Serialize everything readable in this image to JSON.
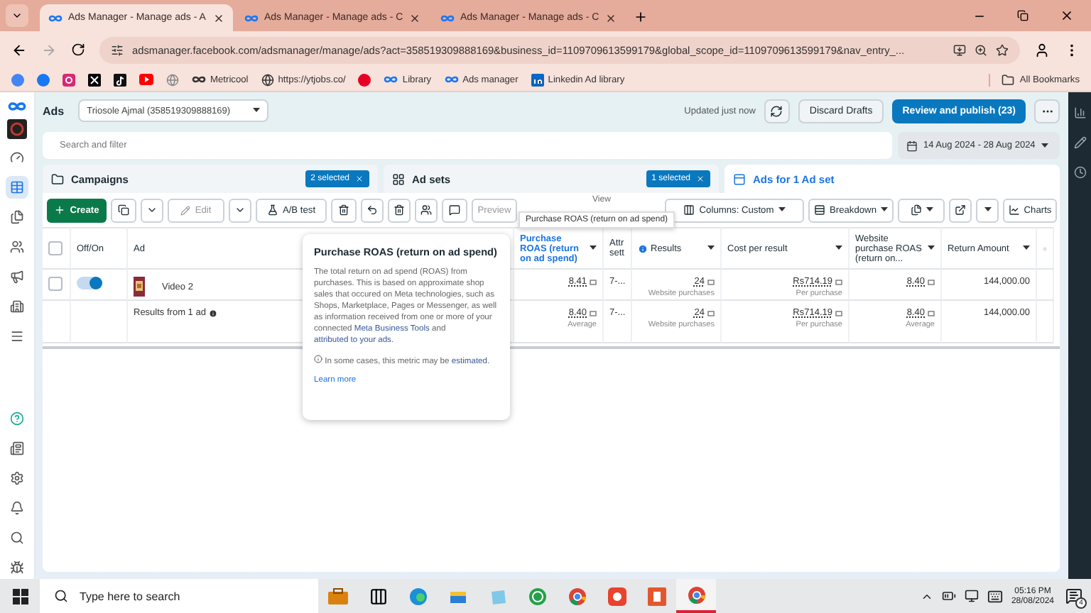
{
  "browser": {
    "tabs": [
      {
        "title": "Ads Manager - Manage ads - A",
        "selected": true
      },
      {
        "title": "Ads Manager - Manage ads - C",
        "selected": false
      },
      {
        "title": "Ads Manager - Manage ads - C",
        "selected": false
      }
    ],
    "url": "adsmanager.facebook.com/adsmanager/manage/ads?act=358519309888169&business_id=1109709613599179&global_scope_id=1109709613599179&nav_entry_...",
    "bookmarks": [
      {
        "kind": "google"
      },
      {
        "kind": "facebook"
      },
      {
        "kind": "instagram"
      },
      {
        "kind": "x"
      },
      {
        "kind": "tiktok"
      },
      {
        "kind": "youtube"
      },
      {
        "kind": "globe"
      },
      {
        "kind": "metricool",
        "label": "Metricool"
      },
      {
        "kind": "world",
        "label": "https://ytjobs.co/"
      },
      {
        "kind": "pinterest"
      },
      {
        "kind": "meta",
        "label": "Library"
      },
      {
        "kind": "meta",
        "label": "Ads manager"
      },
      {
        "kind": "linkedin",
        "label": "Linkedin Ad library"
      }
    ],
    "all_bookmarks": "All Bookmarks"
  },
  "header": {
    "app": "Ads",
    "account": "Triosole Ajmal (358519309888169)",
    "updated": "Updated just now",
    "discard": "Discard Drafts",
    "publish": "Review and publish (23)"
  },
  "search": {
    "placeholder": "Search and filter"
  },
  "date_range": "14 Aug 2024 - 28 Aug 2024",
  "sidebar": {
    "items": [
      {
        "kind": "gauge",
        "selected": false
      },
      {
        "kind": "table",
        "selected": true
      },
      {
        "kind": "pages",
        "selected": false
      },
      {
        "kind": "people",
        "selected": false
      },
      {
        "kind": "megaphone",
        "selected": false
      },
      {
        "kind": "buildings",
        "selected": false
      },
      {
        "kind": "menu",
        "selected": false
      }
    ],
    "bottom": [
      {
        "kind": "help"
      },
      {
        "kind": "news"
      },
      {
        "kind": "settings"
      },
      {
        "kind": "bell"
      },
      {
        "kind": "search"
      },
      {
        "kind": "bug"
      }
    ]
  },
  "levels": [
    {
      "kind": "folder",
      "label": "Campaigns",
      "badge": "2 selected",
      "selected": false
    },
    {
      "kind": "grid",
      "label": "Ad sets",
      "badge": "1 selected",
      "selected": false
    },
    {
      "kind": "ad",
      "label": "Ads for 1 Ad set",
      "selected": true
    }
  ],
  "toolbar": {
    "create": "Create",
    "edit": "Edit",
    "ab_test": "A/B test",
    "preview": "Preview",
    "view": "View",
    "columns": "Columns: Custom",
    "breakdown": "Breakdown",
    "charts": "Charts"
  },
  "table": {
    "columns": [
      {
        "kind": "checkbox",
        "checked": false
      },
      {
        "kind": "text",
        "label": "Off/On",
        "menu": false,
        "highlighted": false
      },
      {
        "kind": "text",
        "label": "Ad",
        "menu": false,
        "highlighted": false
      },
      {
        "kind": "text",
        "label": "Purchase ROAS (return on ad spend)",
        "menu": true,
        "highlighted": true
      },
      {
        "kind": "text",
        "label": "Attr sett",
        "menu": false,
        "highlighted": false
      },
      {
        "kind": "text",
        "label": "Results",
        "menu": true,
        "highlighted": false,
        "info": true
      },
      {
        "kind": "text",
        "label": "Cost per result",
        "menu": true,
        "highlighted": false
      },
      {
        "kind": "text",
        "label": "Website purchase ROAS (return on...",
        "menu": true,
        "highlighted": false
      },
      {
        "kind": "text",
        "label": "Return Amount",
        "menu": true,
        "highlighted": false
      }
    ],
    "rows": [
      {
        "cells": [
          {
            "kind": "checkbox",
            "checked": false
          },
          {
            "kind": "toggle",
            "on": true
          },
          {
            "kind": "ad",
            "value": "Video 2"
          },
          {
            "kind": "metric",
            "value": "8.41"
          },
          {
            "kind": "text",
            "value": "7-..."
          },
          {
            "kind": "metric",
            "value": "24",
            "sub": "Website purchases"
          },
          {
            "kind": "metric",
            "value": "Rs714.19",
            "sub": "Per purchase"
          },
          {
            "kind": "metric",
            "value": "8.40"
          },
          {
            "kind": "number",
            "value": "144,000.00"
          }
        ]
      },
      {
        "cells": [
          {
            "kind": "empty"
          },
          {
            "kind": "empty"
          },
          {
            "kind": "summary",
            "value": "Results from 1 ad"
          },
          {
            "kind": "metric",
            "value": "8.40",
            "sub": "Average"
          },
          {
            "kind": "text",
            "value": "7-..."
          },
          {
            "kind": "metric",
            "value": "24",
            "sub": "Website purchases"
          },
          {
            "kind": "metric",
            "value": "Rs714.19",
            "sub": "Per purchase"
          },
          {
            "kind": "metric",
            "value": "8.40",
            "sub": "Average"
          },
          {
            "kind": "number",
            "value": "144,000.00"
          }
        ]
      }
    ]
  },
  "tooltip": "Purchase ROAS (return on ad spend)",
  "popover": {
    "title": "Purchase ROAS (return on ad spend)",
    "body": [
      {
        "text": "The total return on ad spend (ROAS) from purchases. This is based on approximate shop sales that occured on Meta technologies, such as Shops, Marketplace, Pages or Messenger, as well as information received from one or more of your connected ",
        "link": false
      },
      {
        "text": "Meta Business Tools",
        "link": true
      },
      {
        "text": " and ",
        "link": false
      },
      {
        "text": "attributed to your ads",
        "link": true
      },
      {
        "text": ".",
        "link": false
      }
    ],
    "note": {
      "text": "In some cases, this metric may be ",
      "link": "estimated",
      "end": "."
    },
    "learn_more": "Learn more"
  },
  "taskbar": {
    "search_placeholder": "Type here to search",
    "apps": [
      {
        "kind": "briefcase",
        "active": false
      },
      {
        "kind": "taskview",
        "active": false
      },
      {
        "kind": "edge",
        "active": false
      },
      {
        "kind": "folder",
        "active": false
      },
      {
        "kind": "notes",
        "active": false
      },
      {
        "kind": "whatsapp",
        "active": false
      },
      {
        "kind": "chrome",
        "active": false
      },
      {
        "kind": "recorder",
        "active": false
      },
      {
        "kind": "office",
        "active": false
      },
      {
        "kind": "chrome",
        "active": true
      }
    ],
    "time": "05:16 PM",
    "date": "28/08/2024",
    "notifications": "4"
  }
}
